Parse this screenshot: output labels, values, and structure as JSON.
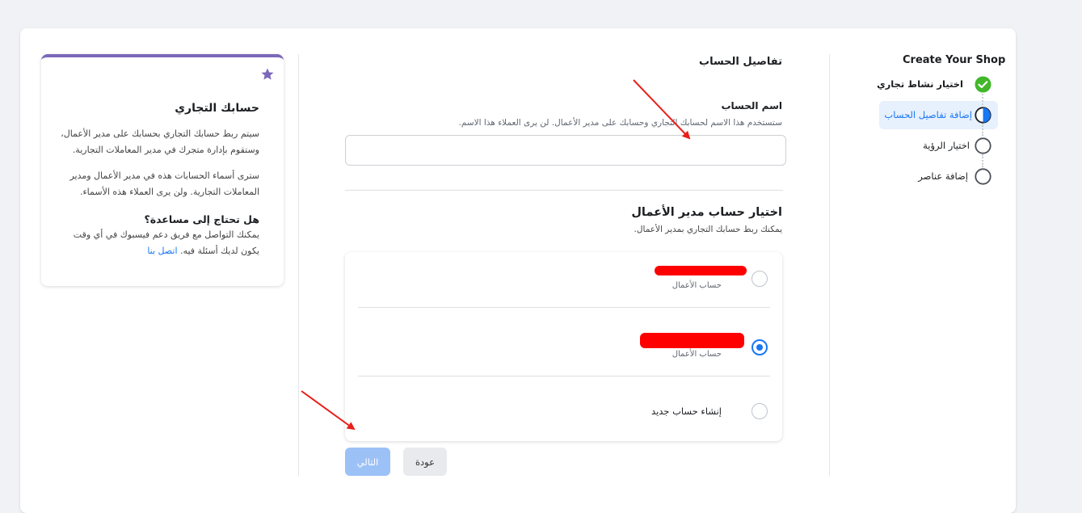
{
  "shop": {
    "title": "Create Your Shop"
  },
  "steps": [
    {
      "label": "اختيار نشاط تجاري",
      "state": "done"
    },
    {
      "label": "إضافة تفاصيل الحساب",
      "state": "active"
    },
    {
      "label": "اختيار الرؤية",
      "state": "pending"
    },
    {
      "label": "إضافة عناصر",
      "state": "pending"
    }
  ],
  "form": {
    "section_title": "تفاصيل الحساب",
    "account_name_label": "اسم الحساب",
    "account_name_help": "ستستخدم هذا الاسم لحسابك التجاري وحسابك على مدير الأعمال. لن يرى العملاء هذا الاسم.",
    "account_name_value": "",
    "bm_title": "اختيار حساب مدير الأعمال",
    "bm_subtitle": "يمكنك ربط حسابك التجاري بمدير الأعمال.",
    "options": [
      {
        "subtitle": "حساب الأعمال",
        "selected": false
      },
      {
        "subtitle": "حساب الأعمال",
        "selected": true
      },
      {
        "label": "إنشاء حساب جديد",
        "selected": false
      }
    ],
    "next_button": "التالي",
    "back_button": "عودة"
  },
  "info": {
    "title": "حسابك التجاري",
    "p1": "سيتم ربط حسابك التجاري بحسابك على مدير الأعمال، وستقوم بإدارة متجرك في مدير المعاملات التجارية.",
    "p2": "سترى أسماء الحسابات هذه في مدير الأعمال ومدير المعاملات التجارية. ولن يرى العملاء هذه الأسماء.",
    "help_title": "هل تحتاج إلى مساعدة؟",
    "help_text": "يمكنك التواصل مع فريق دعم فيسبوك في أي وقت يكون لديك أسئلة فيه.",
    "contact_link": "اتصل بنا"
  },
  "colors": {
    "accent": "#1877f2",
    "success": "#42b72a",
    "annotation": "#e8201a",
    "info_top": "#7b68b8"
  }
}
